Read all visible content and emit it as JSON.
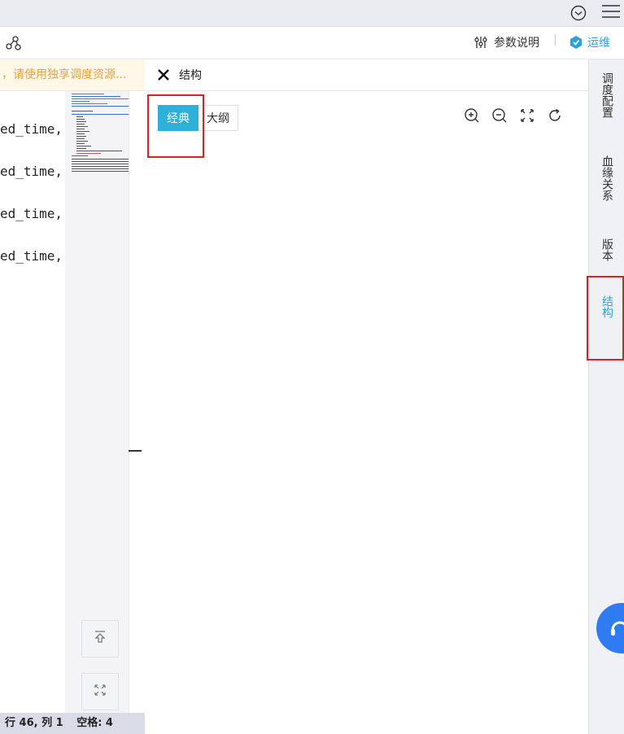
{
  "toolbar": {
    "param_label": "参数说明",
    "divider": "|",
    "ops_label": "运维"
  },
  "editor": {
    "banner_text": "，请使用独享调度资源...",
    "code_lines": [
      "ed_time,",
      "ed_time,",
      "ed_time,",
      "ed_time,"
    ],
    "status": {
      "position": "行 46, 列 1",
      "indent": "空格: 4"
    }
  },
  "panel": {
    "title": "结构",
    "tabs": [
      {
        "label": "经典",
        "active": true
      },
      {
        "label": "大纲",
        "active": false
      }
    ],
    "icons": [
      "zoom-in-icon",
      "zoom-out-icon",
      "fit-screen-icon",
      "refresh-icon"
    ]
  },
  "side_nav": {
    "items": [
      {
        "label": "调度配置",
        "active": false
      },
      {
        "label": "血缘关系",
        "active": false
      },
      {
        "label": "版本",
        "active": false
      },
      {
        "label": "结构",
        "active": true
      }
    ]
  },
  "colors": {
    "accent": "#2eb0d9",
    "active_nav": "#2ea0dc",
    "highlight": "#e0201c",
    "banner_text": "#e6a23c"
  }
}
